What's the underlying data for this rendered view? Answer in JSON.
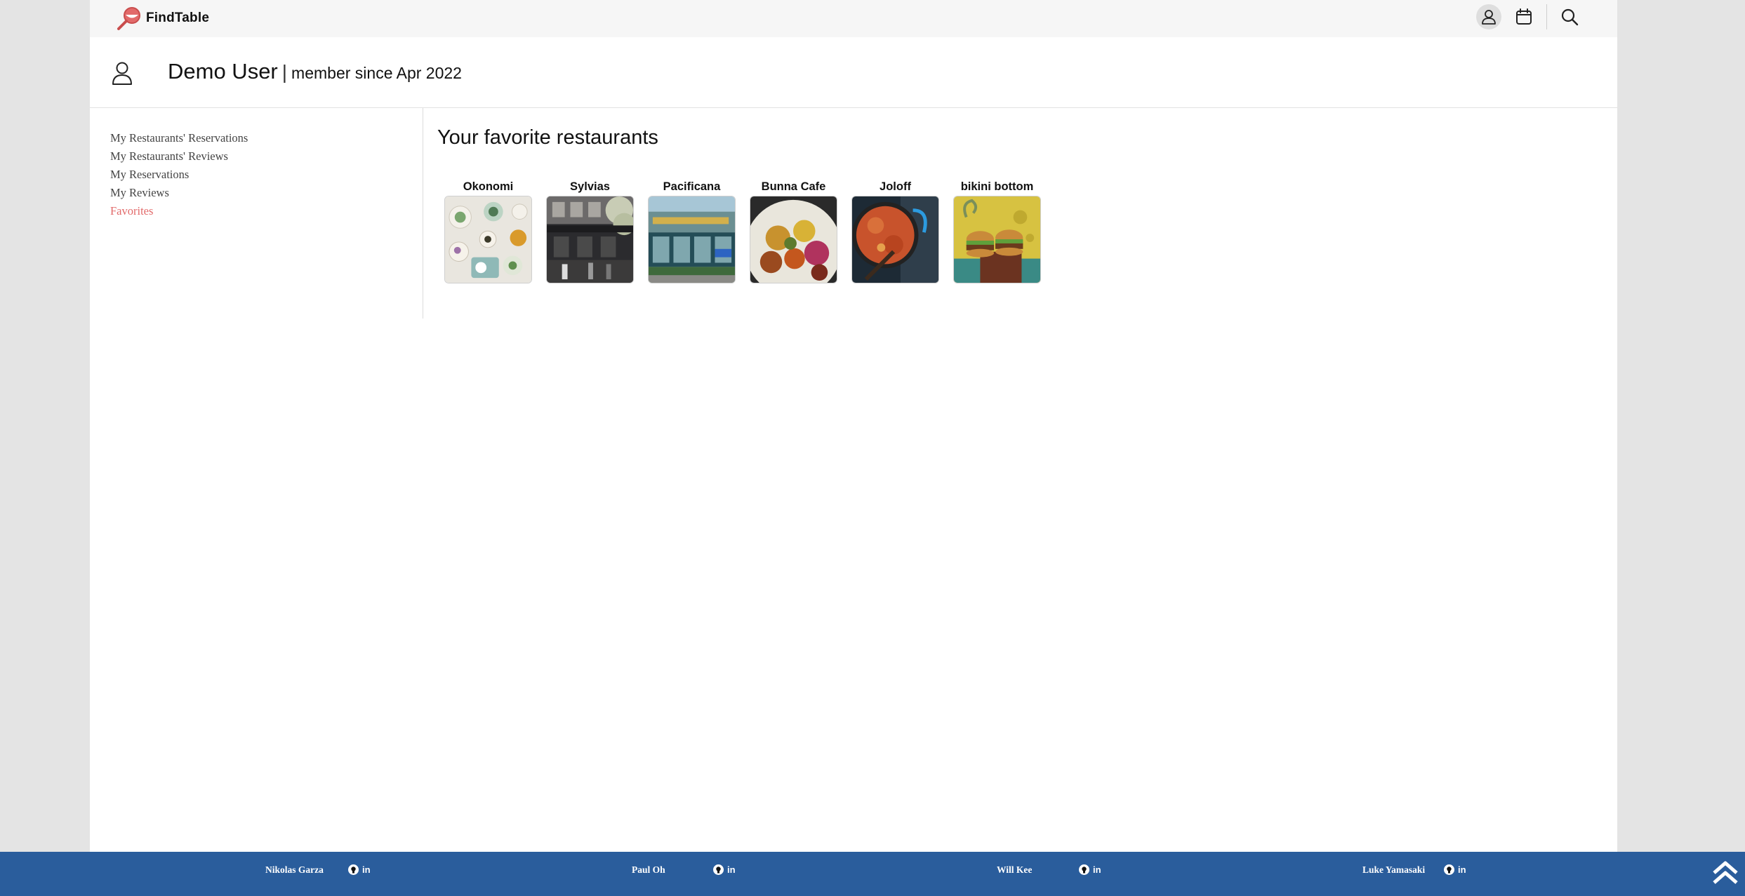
{
  "colors": {
    "accent": "#e26a6a",
    "footer": "#2a5d9c",
    "page_bg": "#e4e4e4",
    "topbar_bg": "#f6f6f6"
  },
  "header": {
    "brand": "FindTable",
    "logo_icon": "magnifier-logo-icon",
    "nav_icons": [
      "user-icon",
      "calendar-icon",
      "search-icon"
    ]
  },
  "profile": {
    "icon": "user-icon",
    "name": "Demo User",
    "separator": "|",
    "member_since": "member since Apr 2022"
  },
  "sidebar": {
    "items": [
      {
        "label": "My Restaurants' Reservations",
        "active": false
      },
      {
        "label": "My Restaurants' Reviews",
        "active": false
      },
      {
        "label": "My Reservations",
        "active": false
      },
      {
        "label": "My Reviews",
        "active": false
      },
      {
        "label": "Favorites",
        "active": true
      }
    ]
  },
  "main": {
    "title": "Your favorite restaurants",
    "favorites": [
      {
        "name": "Okonomi"
      },
      {
        "name": "Sylvias"
      },
      {
        "name": "Pacificana"
      },
      {
        "name": "Bunna Cafe"
      },
      {
        "name": "Joloff"
      },
      {
        "name": "bikini bottom"
      }
    ]
  },
  "footer": {
    "credits": [
      {
        "name": "Nikolas Garza",
        "linkedin": "in"
      },
      {
        "name": "Paul Oh",
        "linkedin": "in"
      },
      {
        "name": "Will Kee",
        "linkedin": "in"
      },
      {
        "name": "Luke Yamasaki",
        "linkedin": "in"
      }
    ],
    "scroll_icon": "double-chevron-up-icon"
  }
}
